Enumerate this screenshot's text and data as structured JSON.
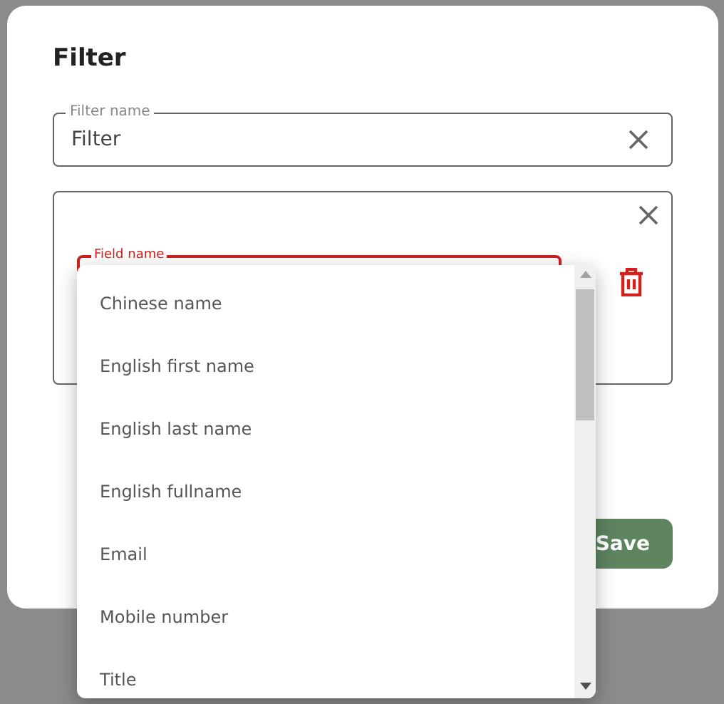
{
  "dialog": {
    "title": "Filter",
    "filter_name": {
      "label": "Filter name",
      "value": "Filter"
    },
    "condition": {
      "field_label": "Field name"
    },
    "buttons": [
      {
        "label": "Save",
        "kind": "primary"
      }
    ]
  },
  "dropdown": {
    "options": [
      {
        "label": "Chinese name"
      },
      {
        "label": "English first name"
      },
      {
        "label": "English last name"
      },
      {
        "label": "English fullname"
      },
      {
        "label": "Email"
      },
      {
        "label": "Mobile number"
      },
      {
        "label": "Title"
      }
    ]
  }
}
